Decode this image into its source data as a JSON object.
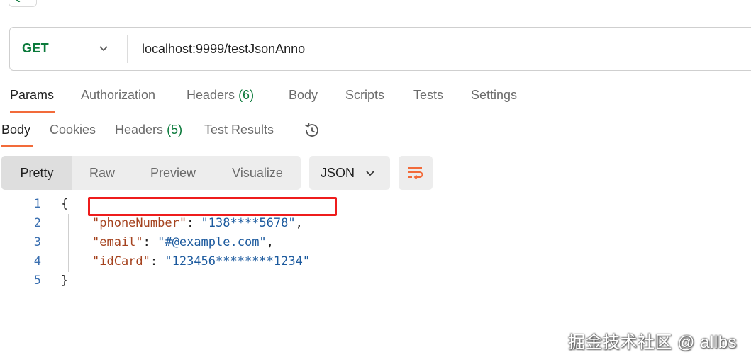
{
  "request": {
    "method": "GET",
    "url": "localhost:9999/testJsonAnno"
  },
  "request_tabs": {
    "params": "Params",
    "authorization": "Authorization",
    "headers": "Headers",
    "headers_count": "(6)",
    "body": "Body",
    "scripts": "Scripts",
    "tests": "Tests",
    "settings": "Settings"
  },
  "response_tabs": {
    "body": "Body",
    "cookies": "Cookies",
    "headers": "Headers",
    "headers_count": "(5)",
    "test_results": "Test Results"
  },
  "view_modes": {
    "pretty": "Pretty",
    "raw": "Raw",
    "preview": "Preview",
    "visualize": "Visualize"
  },
  "format": "JSON",
  "icons": [
    "chevron-left-icon",
    "chevron-down-icon",
    "history-icon",
    "wrap-lines-icon"
  ],
  "accent_color": "#f26b3a",
  "method_color": "#0b7a3b",
  "code": {
    "line_numbers": [
      "1",
      "2",
      "3",
      "4",
      "5"
    ],
    "open_brace": "{",
    "close_brace": "}",
    "fields": [
      {
        "key": "\"phoneNumber\"",
        "value": "\"138****5678\"",
        "trail": ","
      },
      {
        "key": "\"email\"",
        "value": "\"#@example.com\"",
        "trail": ","
      },
      {
        "key": "\"idCard\"",
        "value": "\"123456********1234\"",
        "trail": ""
      }
    ]
  },
  "watermark": "掘金技术社区 @ allbs"
}
